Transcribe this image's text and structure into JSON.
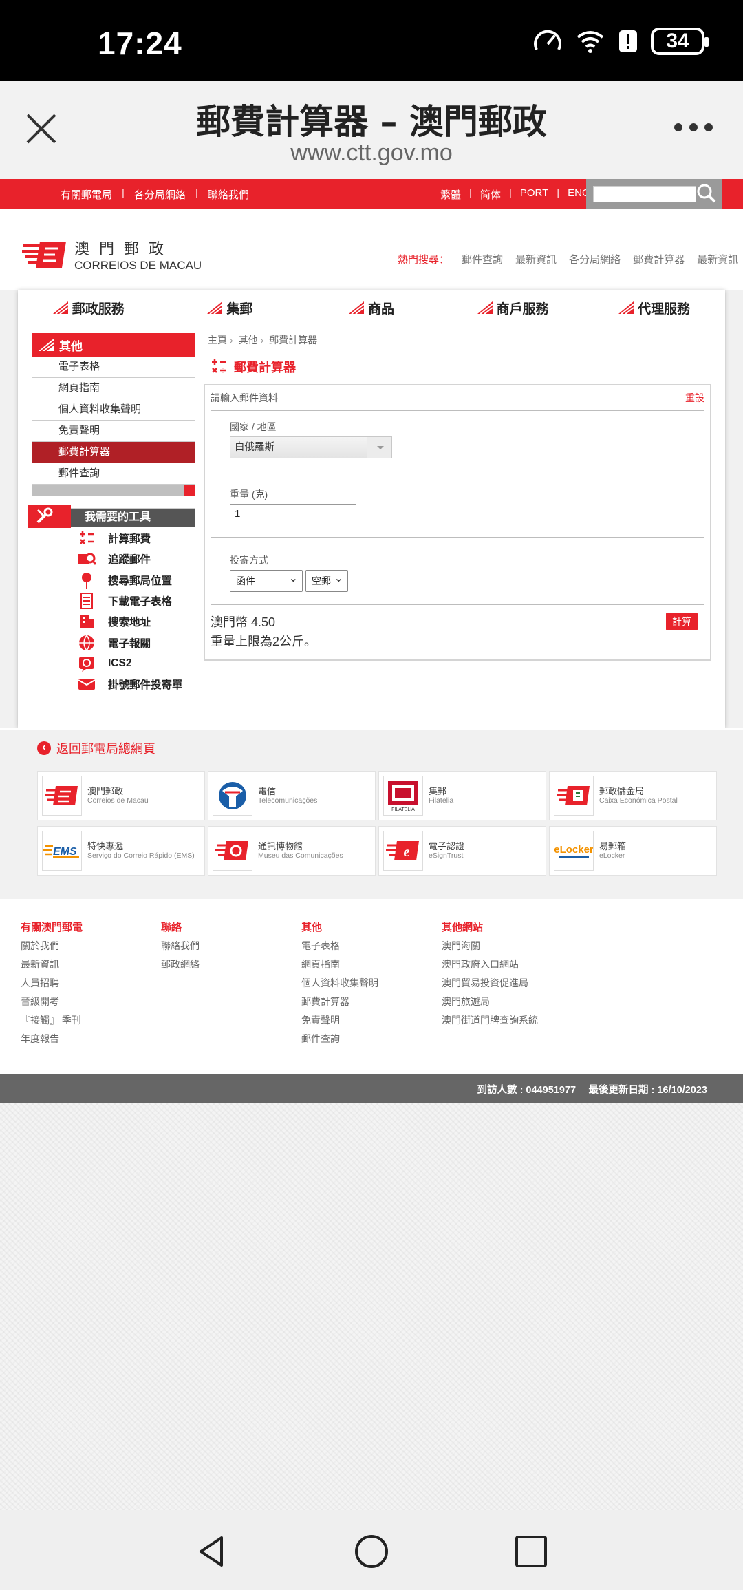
{
  "statusbar": {
    "time": "17:24",
    "battery": "34"
  },
  "browser": {
    "title": "郵費計算器 – 澳門郵政",
    "url": "www.ctt.gov.mo"
  },
  "topbar": {
    "left_links": [
      "有關郵電局",
      "各分局網絡",
      "聯絡我們"
    ],
    "lang_links": [
      "繁體",
      "简体",
      "PORT",
      "ENG"
    ],
    "search_placeholder": ""
  },
  "logo": {
    "cn": "澳門郵政",
    "pt": "CORREIOS DE MACAU"
  },
  "hotsearch": {
    "label": "熱門搜尋：",
    "items": [
      "郵件查詢",
      "最新資訊",
      "各分局網絡",
      "郵費計算器",
      "最新資訊"
    ]
  },
  "mainnav": [
    "郵政服務",
    "集郵",
    "商品",
    "商戶服務",
    "代理服務"
  ],
  "sidebar": {
    "heading": "其他",
    "items": [
      "電子表格",
      "網頁指南",
      "個人資料收集聲明",
      "免責聲明",
      "郵費計算器",
      "郵件查詢"
    ],
    "active_index": 4
  },
  "tools": {
    "heading": "我需要的工具",
    "items": [
      {
        "label": "計算郵費",
        "icon": "calculator-icon"
      },
      {
        "label": "追蹤郵件",
        "icon": "track-mail-icon"
      },
      {
        "label": "搜尋郵局位置",
        "icon": "location-pin-icon"
      },
      {
        "label": "下載電子表格",
        "icon": "document-icon"
      },
      {
        "label": "搜索地址",
        "icon": "building-icon"
      },
      {
        "label": "電子報關",
        "icon": "globe-icon"
      },
      {
        "label": "ICS2",
        "icon": "ics2-icon"
      },
      {
        "label": "掛號郵件投寄單",
        "icon": "envelope-icon"
      }
    ]
  },
  "content": {
    "breadcrumb": [
      "主頁",
      "其他",
      "郵費計算器"
    ],
    "title": "郵費計算器",
    "form_header": "請輸入郵件資料",
    "reset": "重設",
    "country_label": "國家 / 地區",
    "country_value": "白俄羅斯",
    "weight_label": "重量 (克)",
    "weight_value": "1",
    "method_label": "投寄方式",
    "type_value": "函件",
    "mode_value": "空郵",
    "result_price": "澳門幣 4.50",
    "result_note": "重量上限為2公斤。",
    "calc_button": "計算"
  },
  "back_link": "返回郵電局總網頁",
  "links": [
    {
      "name": "澳門郵政",
      "sub": "Correios de Macau"
    },
    {
      "name": "電信",
      "sub": "Telecomunicações"
    },
    {
      "name": "集郵",
      "sub": "Filatelia"
    },
    {
      "name": "郵政儲金局",
      "sub": "Caixa Económica Postal"
    },
    {
      "name": "特快專遞",
      "sub": "Serviço do Correio Rápido (EMS)"
    },
    {
      "name": "通訊博物館",
      "sub": "Museu das Comunicações"
    },
    {
      "name": "電子認證",
      "sub": "eSignTrust"
    },
    {
      "name": "易郵箱",
      "sub": "eLocker"
    }
  ],
  "footer": {
    "col1": {
      "heading": "有關澳門郵電",
      "items": [
        "關於我們",
        "最新資訊",
        "人員招聘",
        "晉級開考",
        "『接觸』 季刊",
        "年度報告"
      ]
    },
    "col2": {
      "heading": "聯絡",
      "items": [
        "聯絡我們",
        "郵政網絡"
      ]
    },
    "col3": {
      "heading": "其他",
      "items": [
        "電子表格",
        "網頁指南",
        "個人資料收集聲明",
        "郵費計算器",
        "免責聲明",
        "郵件查詢"
      ]
    },
    "col4": {
      "heading": "其他網站",
      "items": [
        "澳門海關",
        "澳門政府入口網站",
        "澳門貿易投資促進局",
        "澳門旅遊局",
        "澳門街道門牌查詢系統"
      ]
    }
  },
  "status_strip": "到訪人數 : 044951977　 最後更新日期 : 16/10/2023",
  "colors": {
    "brand_red": "#e8222b",
    "active_red": "#b02026",
    "grey_strip": "#666666"
  }
}
